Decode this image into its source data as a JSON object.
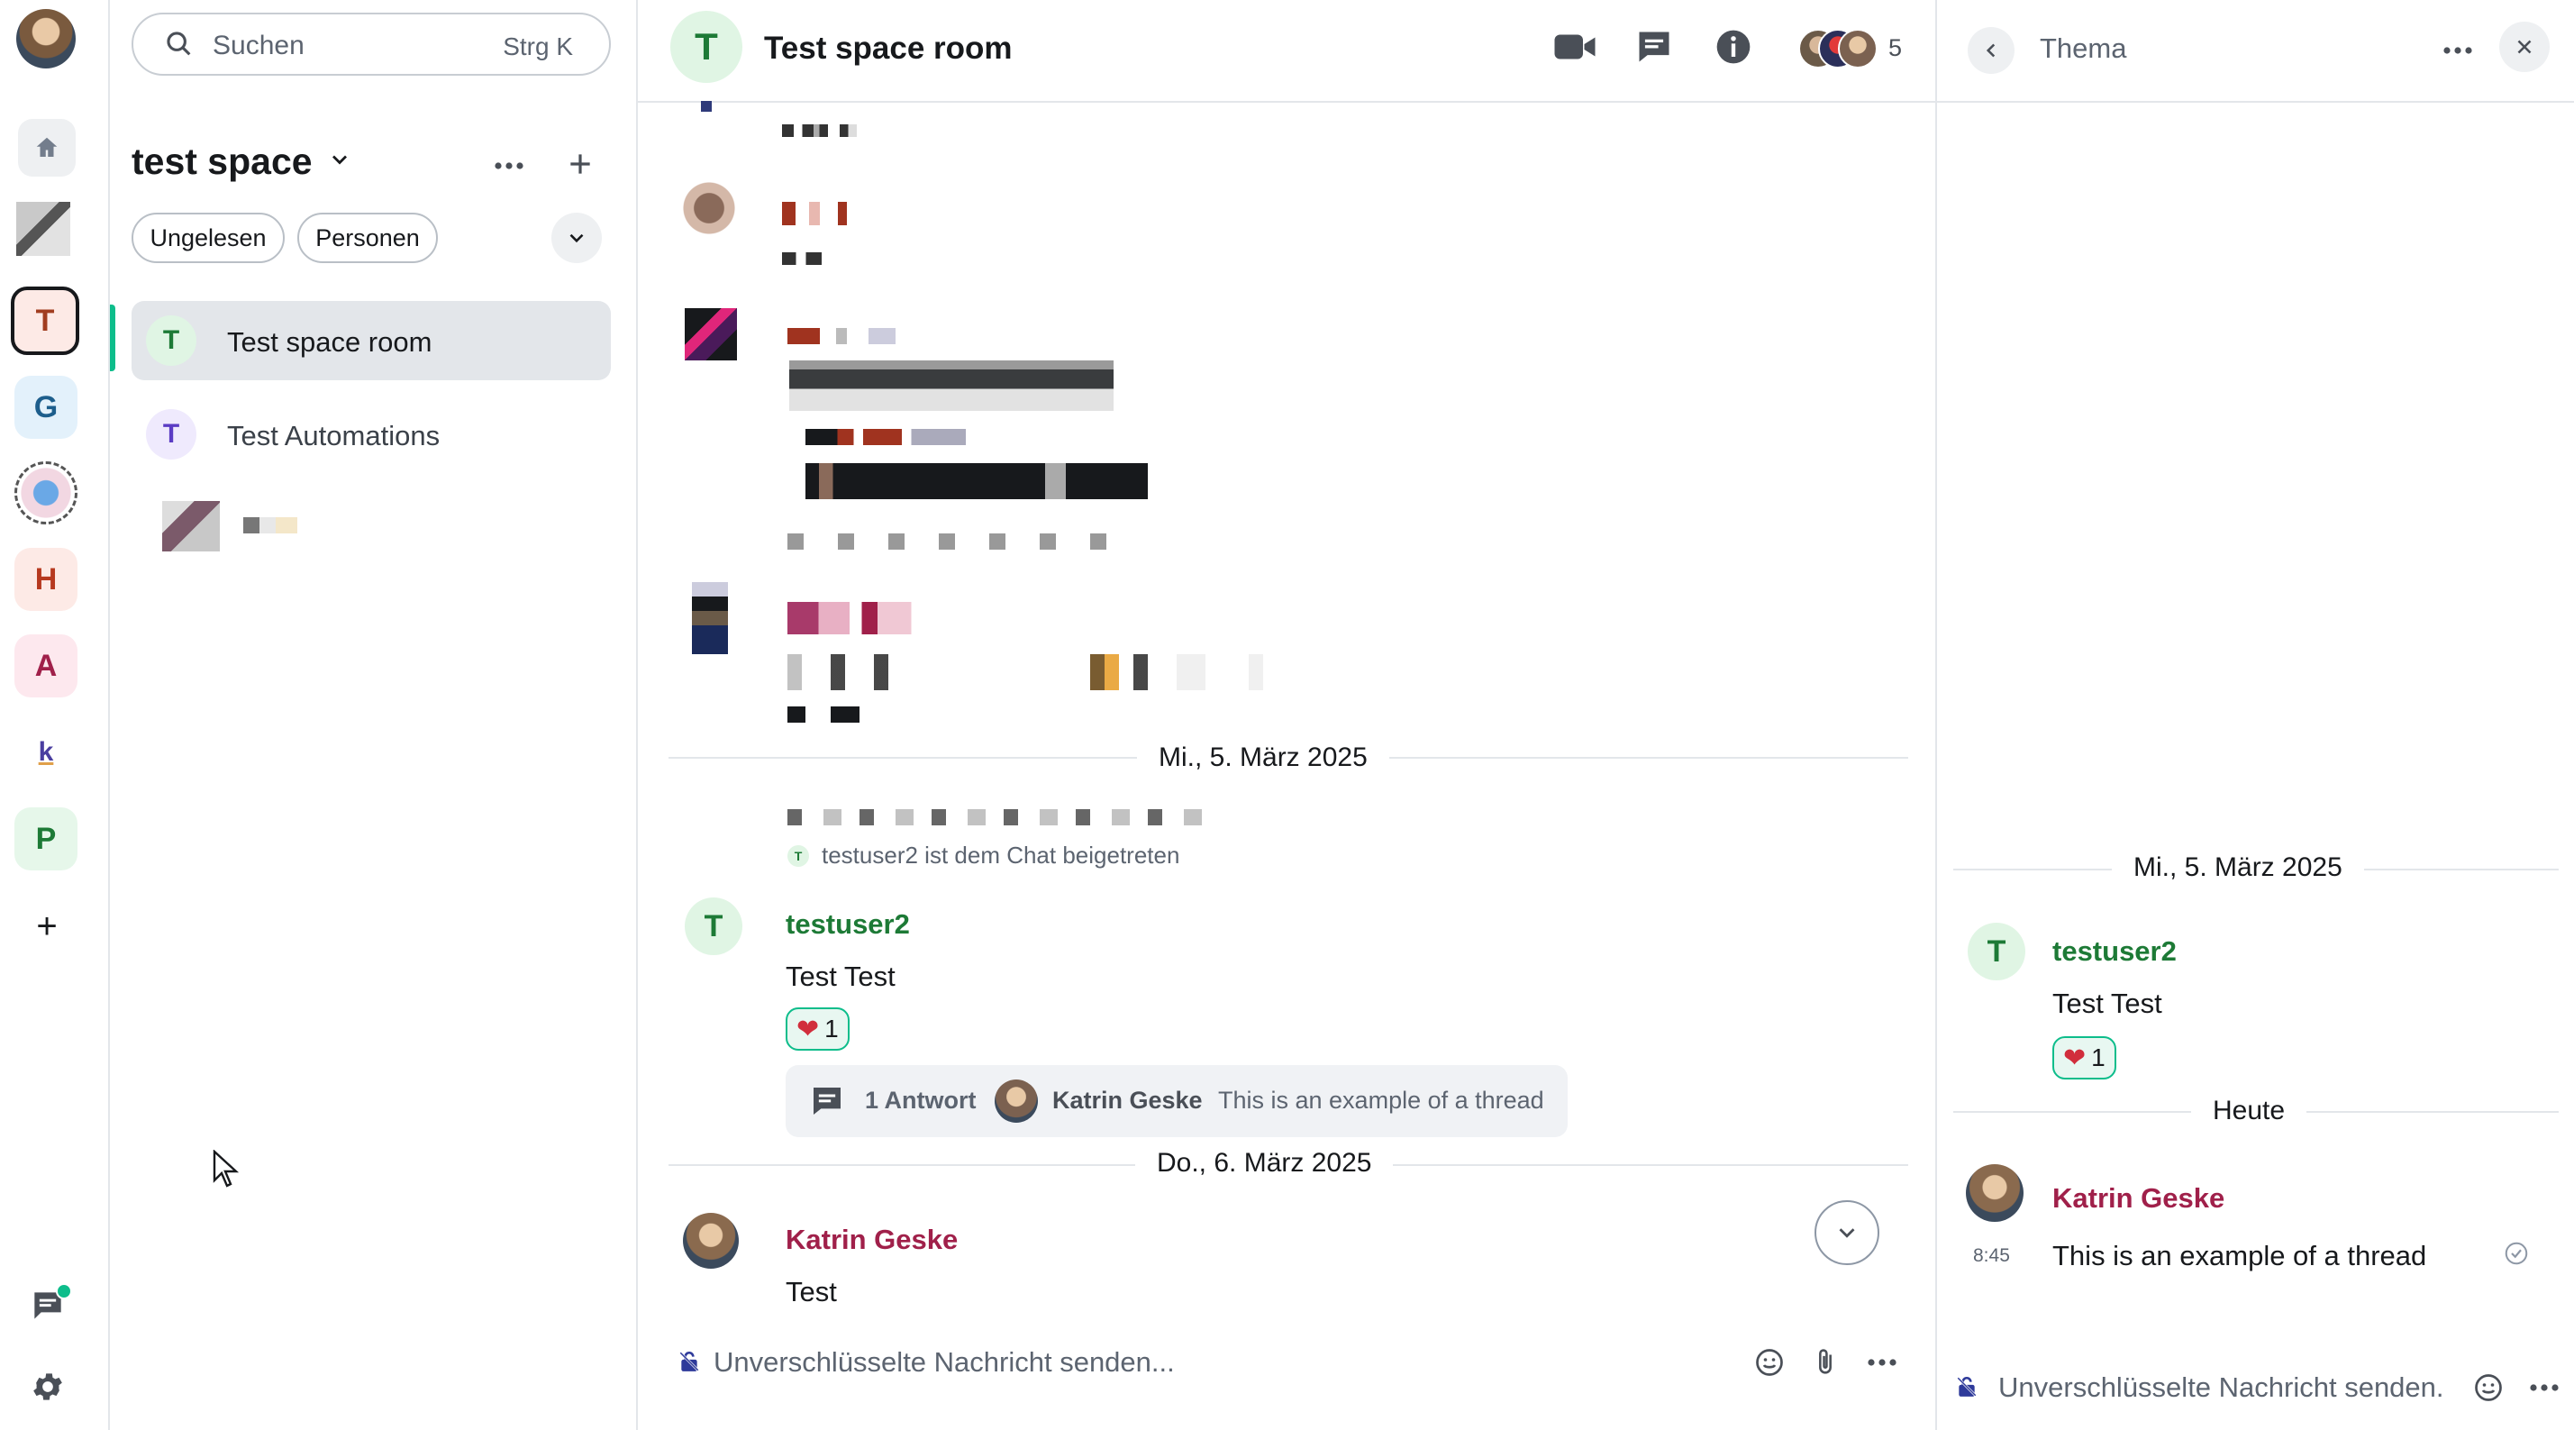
{
  "spaces": {
    "items": [
      {
        "letter": "T",
        "bg": "#fdeae6",
        "fg": "#a13d20",
        "active": true
      },
      {
        "letter": "G",
        "bg": "#e3f1fb",
        "fg": "#1d5e8c"
      },
      {
        "letter": "H",
        "bg": "#fdeae6",
        "fg": "#b6391f"
      },
      {
        "letter": "A",
        "bg": "#fde8ee",
        "fg": "#a0204a"
      },
      {
        "letter": "k",
        "bg": "#ffffff",
        "fg": "#4a3ea0"
      },
      {
        "letter": "P",
        "bg": "#e6f7ea",
        "fg": "#1d7a36"
      }
    ],
    "add_label": "+"
  },
  "search": {
    "placeholder": "Suchen",
    "shortcut": "Strg K"
  },
  "roomlist": {
    "space_title": "test space",
    "filters": [
      "Ungelesen",
      "Personen"
    ],
    "rooms": [
      {
        "letter": "T",
        "name": "Test space room",
        "bg": "#e0f5e4",
        "fg": "#1d7a36",
        "selected": true
      },
      {
        "letter": "T",
        "name": "Test Automations",
        "bg": "#efeafd",
        "fg": "#5b3cc4",
        "selected": false
      }
    ]
  },
  "room": {
    "letter": "T",
    "name": "Test space room",
    "member_count": "5"
  },
  "timeline": {
    "date1": "Mi., 5. März 2025",
    "join_notice": "testuser2 ist dem Chat beigetreten",
    "msg1": {
      "sender": "testuser2",
      "body": "Test Test",
      "reaction": "1"
    },
    "thread_summary": {
      "count": "1 Antwort",
      "author": "Katrin Geske",
      "preview": "This is an example of a thread"
    },
    "date2": "Do., 6. März 2025",
    "msg2": {
      "sender": "Katrin Geske",
      "body": "Test"
    }
  },
  "composer": {
    "placeholder": "Unverschlüsselte Nachricht senden..."
  },
  "thread": {
    "title": "Thema",
    "date": "Mi., 5. März 2025",
    "root": {
      "letter": "T",
      "sender": "testuser2",
      "body": "Test Test",
      "reaction": "1"
    },
    "today": "Heute",
    "reply": {
      "sender": "Katrin Geske",
      "time": "8:45",
      "body": "This is an example of a thread"
    },
    "composer_placeholder": "Unverschlüsselte Nachricht senden."
  },
  "colors": {
    "accent": "#0dbd8b",
    "green_sender": "#1d7a36",
    "pink_sender": "#a0204a"
  }
}
